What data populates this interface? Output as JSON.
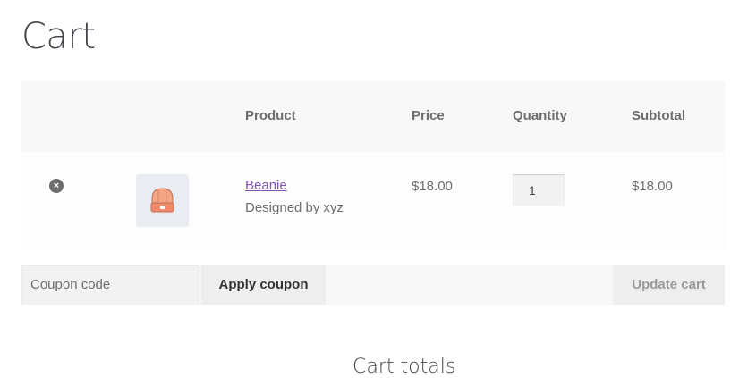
{
  "page": {
    "title": "Cart",
    "totals_heading": "Cart totals"
  },
  "table": {
    "headers": {
      "product": "Product",
      "price": "Price",
      "quantity": "Quantity",
      "subtotal": "Subtotal"
    },
    "rows": [
      {
        "remove_symbol": "×",
        "thumbnail_icon": "beanie-icon",
        "name": "Beanie",
        "meta": "Designed by xyz",
        "price": "$18.00",
        "quantity": "1",
        "subtotal": "$18.00"
      }
    ]
  },
  "actions": {
    "coupon_placeholder": "Coupon code",
    "apply_label": "Apply coupon",
    "update_label": "Update cart"
  },
  "colors": {
    "link": "#7f54b3",
    "header_bg": "#f8f8f8",
    "text": "#43454b",
    "beanie": "#f4a582"
  }
}
